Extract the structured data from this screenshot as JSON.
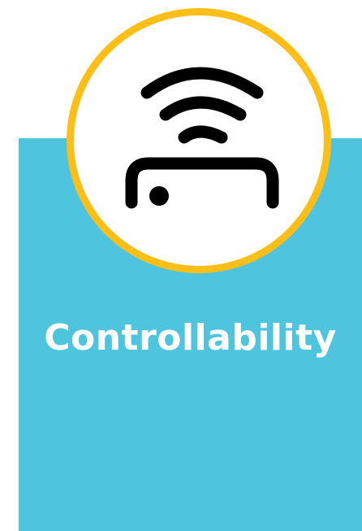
{
  "card": {
    "title": "Controllability",
    "icon": "remote-control-signal-icon",
    "colors": {
      "panel": "#4fc4de",
      "ring": "#fdbf17",
      "icon": "#000000",
      "title_text": "#ffffff"
    }
  }
}
